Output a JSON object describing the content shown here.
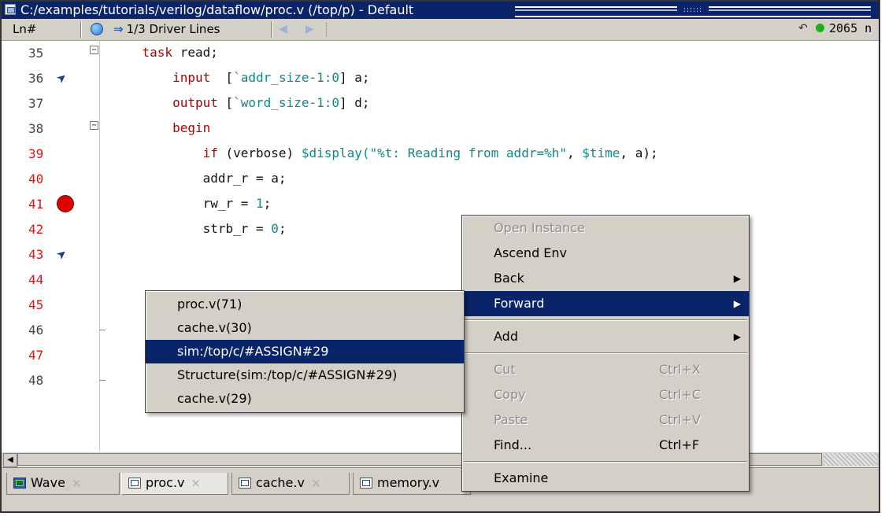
{
  "window": {
    "title": "C:/examples/tutorials/verilog/dataflow/proc.v (/top/p) - Default"
  },
  "toolbar": {
    "ln_header": "Ln#",
    "driver_lines": "1/3 Driver Lines",
    "sim_time": "2065 n"
  },
  "lines": [
    {
      "num": "35",
      "color": "gray",
      "code": [
        {
          "t": "    task ",
          "c": "kw"
        },
        {
          "t": "read;",
          "c": "plain"
        }
      ]
    },
    {
      "num": "36",
      "color": "gray",
      "code": [
        {
          "t": "        input",
          "c": "kw"
        },
        {
          "t": "  [",
          "c": "plain"
        },
        {
          "t": "`addr_size-1:0",
          "c": "mac"
        },
        {
          "t": "] a;",
          "c": "plain"
        }
      ]
    },
    {
      "num": "37",
      "color": "gray",
      "code": [
        {
          "t": "        output",
          "c": "kw"
        },
        {
          "t": " [",
          "c": "plain"
        },
        {
          "t": "`word_size-1:0",
          "c": "mac"
        },
        {
          "t": "] d;",
          "c": "plain"
        }
      ]
    },
    {
      "num": "38",
      "color": "gray",
      "code": [
        {
          "t": "        begin",
          "c": "kw"
        }
      ]
    },
    {
      "num": "39",
      "color": "red",
      "code": [
        {
          "t": "            if",
          "c": "kw"
        },
        {
          "t": " (verbose) ",
          "c": "plain"
        },
        {
          "t": "$display(",
          "c": "str"
        },
        {
          "t": "\"%t: Reading from addr=%h\"",
          "c": "str"
        },
        {
          "t": ", ",
          "c": "plain"
        },
        {
          "t": "$time",
          "c": "str"
        },
        {
          "t": ", a);",
          "c": "plain"
        }
      ]
    },
    {
      "num": "40",
      "color": "red",
      "code": [
        {
          "t": "            addr_r = a;",
          "c": "plain"
        }
      ]
    },
    {
      "num": "41",
      "color": "red",
      "code": [
        {
          "t": "            rw_r = ",
          "c": "plain"
        },
        {
          "t": "1",
          "c": "num"
        },
        {
          "t": ";",
          "c": "plain"
        }
      ]
    },
    {
      "num": "42",
      "color": "red",
      "code": [
        {
          "t": "            strb_r = ",
          "c": "plain"
        },
        {
          "t": "0",
          "c": "num"
        },
        {
          "t": ";",
          "c": "plain"
        }
      ]
    },
    {
      "num": "43",
      "color": "red",
      "code": []
    },
    {
      "num": "44",
      "color": "red",
      "code": []
    },
    {
      "num": "45",
      "color": "red",
      "code": []
    },
    {
      "num": "46",
      "color": "gray",
      "code": []
    },
    {
      "num": "47",
      "color": "red",
      "code": []
    },
    {
      "num": "48",
      "color": "gray",
      "code": []
    }
  ],
  "context_menu": {
    "items": [
      {
        "label": "Open Instance",
        "disabled": true
      },
      {
        "label": "Ascend Env"
      },
      {
        "label": "Back",
        "submenu": true
      },
      {
        "label": "Forward",
        "submenu": true,
        "highlighted": true
      },
      {
        "sep": true
      },
      {
        "label": "Add",
        "submenu": true
      },
      {
        "sep": true
      },
      {
        "label": "Cut",
        "shortcut": "Ctrl+X",
        "disabled": true
      },
      {
        "label": "Copy",
        "shortcut": "Ctrl+C",
        "disabled": true
      },
      {
        "label": "Paste",
        "shortcut": "Ctrl+V",
        "disabled": true
      },
      {
        "label": "Find...",
        "shortcut": "Ctrl+F"
      },
      {
        "sep": true
      },
      {
        "label": "Examine"
      }
    ]
  },
  "forward_submenu": {
    "items": [
      {
        "label": "proc.v(71)"
      },
      {
        "label": "cache.v(30)"
      },
      {
        "label": "sim:/top/c/#ASSIGN#29",
        "highlighted": true
      },
      {
        "label": "Structure(sim:/top/c/#ASSIGN#29)"
      },
      {
        "label": "cache.v(29)"
      }
    ]
  },
  "tabs": [
    {
      "label": "Wave",
      "icon": "wave-icon"
    },
    {
      "label": "proc.v",
      "icon": "source-file-icon",
      "active": true
    },
    {
      "label": "cache.v",
      "icon": "source-file-icon"
    },
    {
      "label": "memory.v",
      "icon": "source-file-icon"
    }
  ],
  "icons": {
    "close": "×",
    "submenu_arrow": "▶",
    "left_arrow": "◀"
  }
}
